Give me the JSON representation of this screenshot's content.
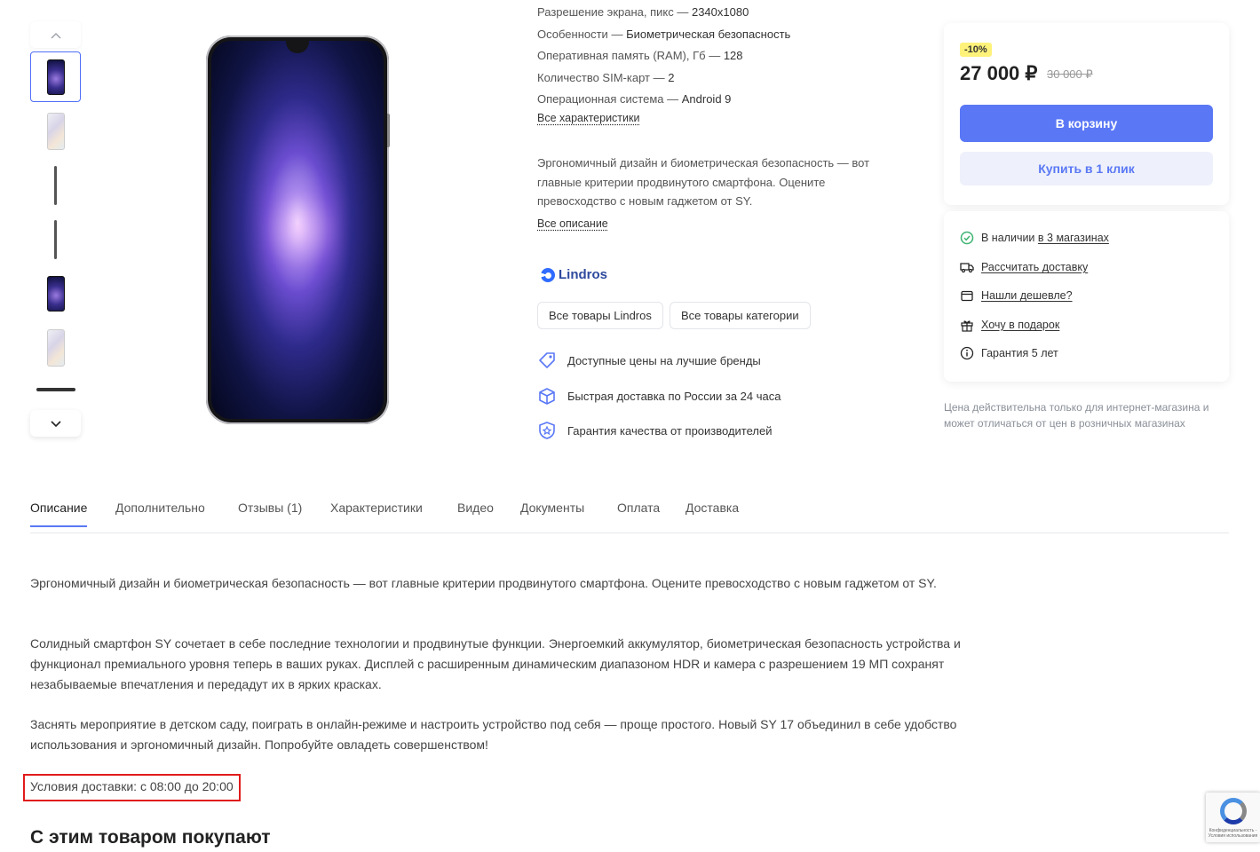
{
  "gallery": {
    "up_icon": "chevron-up-icon",
    "down_icon": "chevron-down-icon"
  },
  "specs": [
    {
      "label": "Разрешение экрана, пикс",
      "value": "2340x1080"
    },
    {
      "label": "Особенности",
      "value": "Биометрическая безопасность"
    },
    {
      "label": "Оперативная память (RAM), Гб",
      "value": "128"
    },
    {
      "label": "Количество SIM-карт",
      "value": "2"
    },
    {
      "label": "Операционная система",
      "value": "Android 9"
    }
  ],
  "spec_sep": " — ",
  "all_specs_link": "Все характеристики",
  "short_description": "Эргономичный дизайн и биометрическая безопасность — вот главные критерии продвинутого смартфона. Оцените превосходство с новым гаджетом от SY.",
  "all_description_link": "Все описание",
  "brand": {
    "name": "Lindros"
  },
  "chips": {
    "brand_goods": "Все товары Lindros",
    "category_goods": "Все товары категории"
  },
  "features": [
    {
      "icon": "price-tag-icon",
      "text": "Доступные цены на лучшие бренды"
    },
    {
      "icon": "box-icon",
      "text": "Быстрая доставка по России за 24 часа"
    },
    {
      "icon": "quality-shield-icon",
      "text": "Гарантия качества от производителей"
    }
  ],
  "price_card": {
    "discount": "-10%",
    "price": "27 000 ₽",
    "old_price": "30 000 ₽",
    "cart_button": "В корзину",
    "one_click_button": "Купить в 1 клик",
    "accent_color": "#5a78f5"
  },
  "info": {
    "stock_prefix": "В наличии ",
    "stock_link": "в 3 магазинах",
    "delivery": "Рассчитать доставку",
    "cheaper": "Нашли дешевле?",
    "gift": "Хочу в подарок",
    "warranty": "Гарантия 5 лет"
  },
  "price_note": "Цена действительна только для интернет-магазина и может отличаться от цен в розничных магазинах",
  "tabs": [
    "Описание",
    "Дополнительно",
    "Отзывы (1)",
    "Характеристики",
    "Видео",
    "Документы",
    "Оплата",
    "Доставка"
  ],
  "description": {
    "p1": "Эргономичный дизайн и биометрическая безопасность — вот главные критерии продвинутого смартфона. Оцените превосходство с новым гаджетом от SY.",
    "p2": "Солидный смартфон SY сочетает в себе последние технологии и продвинутые функции. Энергоемкий аккумулятор, биометрическая безопасность устройства и функционал премиального уровня теперь в ваших руках. Дисплей с расширенным динамическим диапазоном HDR и камера с разрешением 19 МП сохранят незабываемые впечатления и передадут их в ярких красках.",
    "p3": "Заснять мероприятие в детском саду, поиграть в онлайн-режиме и настроить устройство под себя — проще простого. Новый SY 17 объединил в себе удобство использования и эргономичный дизайн. Попробуйте овладеть совершенством!",
    "delivery_conditions": "Условия доставки: с 08:00 до 20:00"
  },
  "related_title": "С этим товаром покупают",
  "recaptcha": {
    "text": "Конфиденциальность - Условия использования"
  }
}
